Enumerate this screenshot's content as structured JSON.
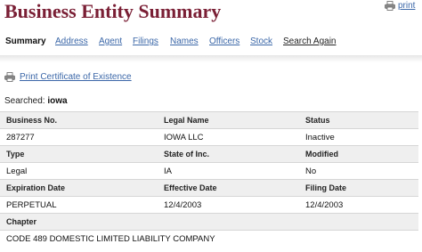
{
  "header": {
    "title": "Business Entity Summary",
    "print_label": "print"
  },
  "nav": {
    "items": [
      "Summary",
      "Address",
      "Agent",
      "Filings",
      "Names",
      "Officers",
      "Stock",
      "Search Again"
    ],
    "active": "Summary"
  },
  "certificate_link": "Print Certificate of Existence",
  "search": {
    "label": "Searched:",
    "term": "iowa"
  },
  "table": {
    "rows": [
      {
        "headers": [
          "Business No.",
          "Legal Name",
          "Status"
        ],
        "values": [
          "287277",
          "IOWA LLC",
          "Inactive"
        ]
      },
      {
        "headers": [
          "Type",
          "State of Inc.",
          "Modified"
        ],
        "values": [
          "Legal",
          "IA",
          "No"
        ]
      },
      {
        "headers": [
          "Expiration Date",
          "Effective Date",
          "Filing Date"
        ],
        "values": [
          "PERPETUAL",
          "12/4/2003",
          "12/4/2003"
        ]
      },
      {
        "headers": [
          "Chapter",
          "",
          ""
        ],
        "values": [
          "CODE 489 DOMESTIC LIMITED LIABILITY COMPANY",
          "",
          ""
        ]
      }
    ]
  },
  "icons": {
    "print": "printer-icon",
    "certificate": "printer-icon"
  }
}
